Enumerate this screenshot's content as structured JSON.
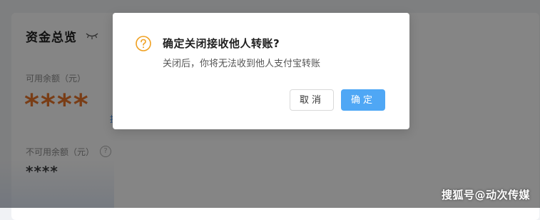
{
  "card": {
    "title": "资金总览",
    "available_label": "可用余额（元）",
    "available_value": "****",
    "side_link": "提",
    "unavailable_label": "不可用余额（元）",
    "unavailable_value": "****",
    "eye_icon": "eye-closed-icon",
    "help_icon": "question-circle-icon",
    "help_glyph": "?"
  },
  "modal": {
    "icon": "question-circle-icon",
    "icon_color": "#f0a020",
    "title": "确定关闭接收他人转账?",
    "content": "关闭后，你将无法收到他人支付宝转账",
    "cancel_label": "取消",
    "ok_label": "确定",
    "ok_color": "#4fa7f5"
  },
  "watermark": "搜狐号@动次传媒",
  "colors": {
    "accent_orange": "#e8752b",
    "link_blue": "#4a90e2"
  }
}
